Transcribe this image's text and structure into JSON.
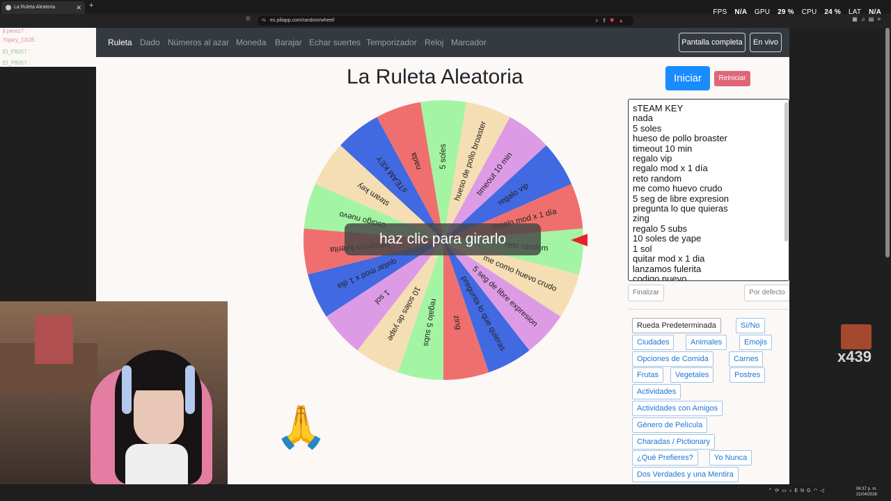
{
  "browser": {
    "tab_title": "La Ruleta Aleatoria",
    "url": "es.piliapp.com/random/wheel/"
  },
  "overlay": {
    "fps_label": "FPS",
    "fps_value": "N/A",
    "gpu_label": "GPU",
    "gpu_value": "29 %",
    "cpu_label": "CPU",
    "cpu_value": "24 %",
    "lat_label": "LAT",
    "lat_value": "N/A"
  },
  "chat": [
    {
      "user": "jl.perez7 :",
      "style": "pink"
    },
    {
      "user": "Yojary_G535 :",
      "style": "pink"
    },
    {
      "user": "El_P8057 :",
      "style": "green"
    },
    {
      "user": "El_P8057 :",
      "style": "green"
    }
  ],
  "nav": {
    "items": [
      "Ruleta",
      "Dado",
      "Números al azar",
      "Moneda",
      "Barajar",
      "Echar suertes",
      "Temporizador",
      "Reloj",
      "Marcador"
    ],
    "fullscreen": "Pantalla completa",
    "live": "En vivo"
  },
  "page_title": "La Ruleta Aleatoria",
  "buttons": {
    "start": "Iniciar",
    "reset": "Reiniciar",
    "finish": "Finalizar",
    "default": "Por defecto"
  },
  "wheel": {
    "hint": "haz clic para girarlo",
    "segments": [
      {
        "label": "5 soles",
        "color": "#a3f5a3"
      },
      {
        "label": "hueso de pollo broaster",
        "color": "#f5deb3"
      },
      {
        "label": "timeout 10 min",
        "color": "#dd9be6"
      },
      {
        "label": "regalo vip",
        "color": "#4169e1"
      },
      {
        "label": "regalo mod x 1 día",
        "color": "#ef6f6f"
      },
      {
        "label": "reto random",
        "color": "#a3f5a3"
      },
      {
        "label": "me como huevo crudo",
        "color": "#f5deb3"
      },
      {
        "label": "5 seg de libre expresion",
        "color": "#dd9be6"
      },
      {
        "label": "pregunta lo que quieras",
        "color": "#4169e1"
      },
      {
        "label": "zing",
        "color": "#ef6f6f"
      },
      {
        "label": "regalo 5 subs",
        "color": "#a3f5a3"
      },
      {
        "label": "10 soles de yape",
        "color": "#f5deb3"
      },
      {
        "label": "1 sol",
        "color": "#dd9be6"
      },
      {
        "label": "quitar mod x 1 dia",
        "color": "#4169e1"
      },
      {
        "label": "lanzamos fulerita",
        "color": "#ef6f6f"
      },
      {
        "label": "codigo nuevo",
        "color": "#a3f5a3"
      },
      {
        "label": "steam key",
        "color": "#f5deb3"
      },
      {
        "label": "sTEAM KEY",
        "color": "#4169e1"
      },
      {
        "label": "nada",
        "color": "#ef6f6f"
      }
    ]
  },
  "list": [
    "sTEAM KEY",
    "nada",
    "5 soles",
    "hueso de pollo broaster",
    "timeout 10 min",
    "regalo vip",
    "regalo mod x 1 día",
    "reto random",
    "me como huevo crudo",
    "5 seg de libre expresion",
    "pregunta lo que quieras",
    "zing",
    "regalo 5 subs",
    "10 soles de yape",
    "1 sol",
    "quitar mod x 1 dia",
    "lanzamos fulerita",
    "codigo nuevo"
  ],
  "presets": [
    "Rueda Predeterminada",
    "Sí/No",
    "Ciudades",
    "Animales",
    "Emojis",
    "Opciones de Comida",
    "Carnes",
    "Frutas",
    "Vegetales",
    "Postres",
    "Actividades",
    "Actividades con Amigos",
    "Género de Película",
    "Charadas / Pictionary",
    "¿Qué Prefieres?",
    "Yo Nunca",
    "Dos Verdades y una Mentira"
  ],
  "emote_count": "x439",
  "taskbar": {
    "lang": "ENG",
    "time": "06:37 p. m.",
    "date": "21/04/2026"
  }
}
